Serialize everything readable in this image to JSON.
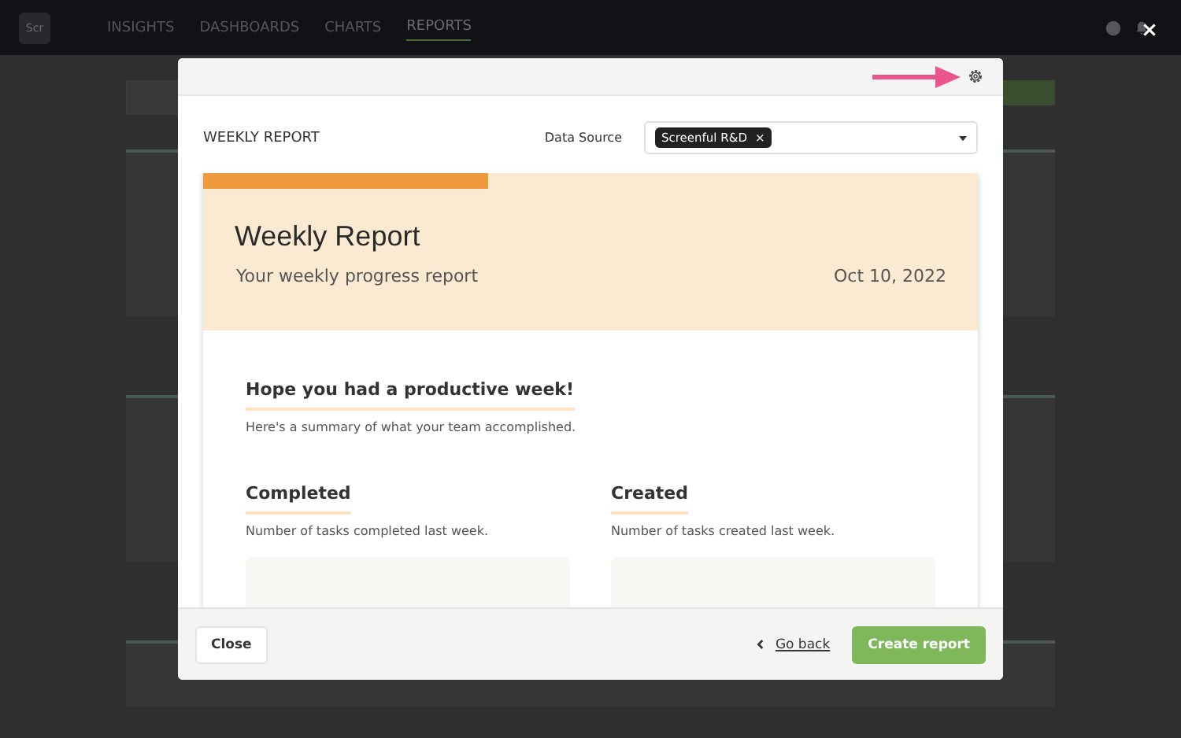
{
  "nav": {
    "logo": "Scr",
    "items": [
      {
        "label": "INSIGHTS",
        "selected": false
      },
      {
        "label": "DASHBOARDS",
        "selected": false
      },
      {
        "label": "CHARTS",
        "selected": false
      },
      {
        "label": "REPORTS",
        "selected": true
      }
    ]
  },
  "modal": {
    "title": "WEEKLY REPORT",
    "data_source": {
      "label": "Data Source",
      "tags": [
        "Screenful R&D"
      ],
      "remove": "×"
    },
    "report": {
      "title": "Weekly Report",
      "subtitle": "Your weekly progress report",
      "date": "Oct 10, 2022",
      "intro": {
        "heading": "Hope you had a productive week!",
        "text": "Here's a summary of what your team accomplished."
      },
      "sections": [
        {
          "heading": "Completed",
          "text": "Number of tasks completed last week."
        },
        {
          "heading": "Created",
          "text": "Number of tasks created last week."
        }
      ]
    },
    "footer": {
      "close": "Close",
      "back": "Go back",
      "create": "Create report"
    }
  }
}
